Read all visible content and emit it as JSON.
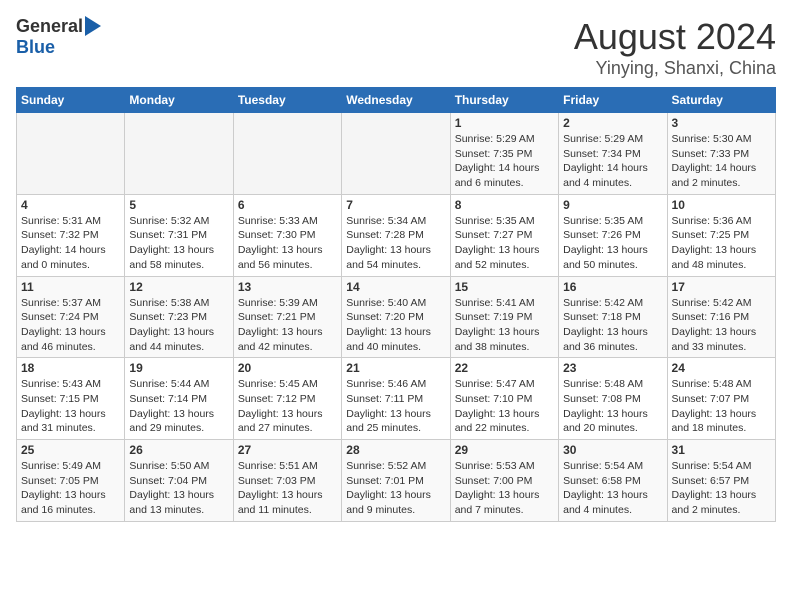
{
  "logo": {
    "general": "General",
    "blue": "Blue"
  },
  "title": "August 2024",
  "subtitle": "Yinying, Shanxi, China",
  "days_of_week": [
    "Sunday",
    "Monday",
    "Tuesday",
    "Wednesday",
    "Thursday",
    "Friday",
    "Saturday"
  ],
  "weeks": [
    [
      {
        "day": "",
        "info": ""
      },
      {
        "day": "",
        "info": ""
      },
      {
        "day": "",
        "info": ""
      },
      {
        "day": "",
        "info": ""
      },
      {
        "day": "1",
        "info": "Sunrise: 5:29 AM\nSunset: 7:35 PM\nDaylight: 14 hours\nand 6 minutes."
      },
      {
        "day": "2",
        "info": "Sunrise: 5:29 AM\nSunset: 7:34 PM\nDaylight: 14 hours\nand 4 minutes."
      },
      {
        "day": "3",
        "info": "Sunrise: 5:30 AM\nSunset: 7:33 PM\nDaylight: 14 hours\nand 2 minutes."
      }
    ],
    [
      {
        "day": "4",
        "info": "Sunrise: 5:31 AM\nSunset: 7:32 PM\nDaylight: 14 hours\nand 0 minutes."
      },
      {
        "day": "5",
        "info": "Sunrise: 5:32 AM\nSunset: 7:31 PM\nDaylight: 13 hours\nand 58 minutes."
      },
      {
        "day": "6",
        "info": "Sunrise: 5:33 AM\nSunset: 7:30 PM\nDaylight: 13 hours\nand 56 minutes."
      },
      {
        "day": "7",
        "info": "Sunrise: 5:34 AM\nSunset: 7:28 PM\nDaylight: 13 hours\nand 54 minutes."
      },
      {
        "day": "8",
        "info": "Sunrise: 5:35 AM\nSunset: 7:27 PM\nDaylight: 13 hours\nand 52 minutes."
      },
      {
        "day": "9",
        "info": "Sunrise: 5:35 AM\nSunset: 7:26 PM\nDaylight: 13 hours\nand 50 minutes."
      },
      {
        "day": "10",
        "info": "Sunrise: 5:36 AM\nSunset: 7:25 PM\nDaylight: 13 hours\nand 48 minutes."
      }
    ],
    [
      {
        "day": "11",
        "info": "Sunrise: 5:37 AM\nSunset: 7:24 PM\nDaylight: 13 hours\nand 46 minutes."
      },
      {
        "day": "12",
        "info": "Sunrise: 5:38 AM\nSunset: 7:23 PM\nDaylight: 13 hours\nand 44 minutes."
      },
      {
        "day": "13",
        "info": "Sunrise: 5:39 AM\nSunset: 7:21 PM\nDaylight: 13 hours\nand 42 minutes."
      },
      {
        "day": "14",
        "info": "Sunrise: 5:40 AM\nSunset: 7:20 PM\nDaylight: 13 hours\nand 40 minutes."
      },
      {
        "day": "15",
        "info": "Sunrise: 5:41 AM\nSunset: 7:19 PM\nDaylight: 13 hours\nand 38 minutes."
      },
      {
        "day": "16",
        "info": "Sunrise: 5:42 AM\nSunset: 7:18 PM\nDaylight: 13 hours\nand 36 minutes."
      },
      {
        "day": "17",
        "info": "Sunrise: 5:42 AM\nSunset: 7:16 PM\nDaylight: 13 hours\nand 33 minutes."
      }
    ],
    [
      {
        "day": "18",
        "info": "Sunrise: 5:43 AM\nSunset: 7:15 PM\nDaylight: 13 hours\nand 31 minutes."
      },
      {
        "day": "19",
        "info": "Sunrise: 5:44 AM\nSunset: 7:14 PM\nDaylight: 13 hours\nand 29 minutes."
      },
      {
        "day": "20",
        "info": "Sunrise: 5:45 AM\nSunset: 7:12 PM\nDaylight: 13 hours\nand 27 minutes."
      },
      {
        "day": "21",
        "info": "Sunrise: 5:46 AM\nSunset: 7:11 PM\nDaylight: 13 hours\nand 25 minutes."
      },
      {
        "day": "22",
        "info": "Sunrise: 5:47 AM\nSunset: 7:10 PM\nDaylight: 13 hours\nand 22 minutes."
      },
      {
        "day": "23",
        "info": "Sunrise: 5:48 AM\nSunset: 7:08 PM\nDaylight: 13 hours\nand 20 minutes."
      },
      {
        "day": "24",
        "info": "Sunrise: 5:48 AM\nSunset: 7:07 PM\nDaylight: 13 hours\nand 18 minutes."
      }
    ],
    [
      {
        "day": "25",
        "info": "Sunrise: 5:49 AM\nSunset: 7:05 PM\nDaylight: 13 hours\nand 16 minutes."
      },
      {
        "day": "26",
        "info": "Sunrise: 5:50 AM\nSunset: 7:04 PM\nDaylight: 13 hours\nand 13 minutes."
      },
      {
        "day": "27",
        "info": "Sunrise: 5:51 AM\nSunset: 7:03 PM\nDaylight: 13 hours\nand 11 minutes."
      },
      {
        "day": "28",
        "info": "Sunrise: 5:52 AM\nSunset: 7:01 PM\nDaylight: 13 hours\nand 9 minutes."
      },
      {
        "day": "29",
        "info": "Sunrise: 5:53 AM\nSunset: 7:00 PM\nDaylight: 13 hours\nand 7 minutes."
      },
      {
        "day": "30",
        "info": "Sunrise: 5:54 AM\nSunset: 6:58 PM\nDaylight: 13 hours\nand 4 minutes."
      },
      {
        "day": "31",
        "info": "Sunrise: 5:54 AM\nSunset: 6:57 PM\nDaylight: 13 hours\nand 2 minutes."
      }
    ]
  ]
}
